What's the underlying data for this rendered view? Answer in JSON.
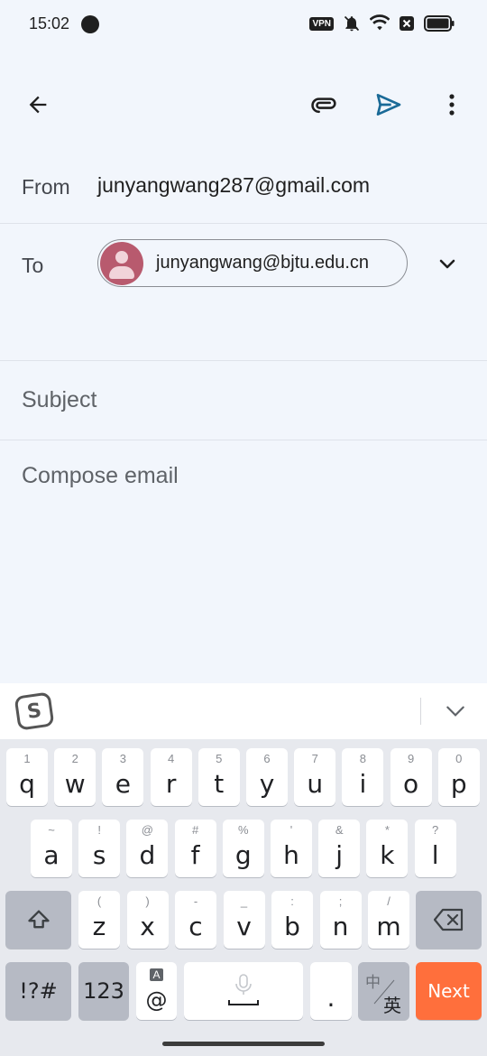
{
  "status_bar": {
    "time": "15:02",
    "vpn_label": "VPN",
    "icons": [
      "app-notification-icon",
      "vpn-icon",
      "mute-icon",
      "wifi-icon",
      "no-sim-icon",
      "battery-icon"
    ]
  },
  "toolbar": {
    "icons": [
      "back-arrow-icon",
      "attach-icon",
      "send-icon",
      "more-vert-icon"
    ],
    "accent_color": "#1a6a97"
  },
  "compose": {
    "from_label": "From",
    "from_value": "junyangwang287@gmail.com",
    "to_label": "To",
    "to_chip": "junyangwang@bjtu.edu.cn",
    "subject_placeholder": "Subject",
    "body_placeholder": "Compose email"
  },
  "keyboard": {
    "row1": [
      {
        "key": "q",
        "hint": "1"
      },
      {
        "key": "w",
        "hint": "2"
      },
      {
        "key": "e",
        "hint": "3"
      },
      {
        "key": "r",
        "hint": "4"
      },
      {
        "key": "t",
        "hint": "5"
      },
      {
        "key": "y",
        "hint": "6"
      },
      {
        "key": "u",
        "hint": "7"
      },
      {
        "key": "i",
        "hint": "8"
      },
      {
        "key": "o",
        "hint": "9"
      },
      {
        "key": "p",
        "hint": "0"
      }
    ],
    "row2": [
      {
        "key": "a",
        "hint": "~"
      },
      {
        "key": "s",
        "hint": "!"
      },
      {
        "key": "d",
        "hint": "@"
      },
      {
        "key": "f",
        "hint": "#"
      },
      {
        "key": "g",
        "hint": "%"
      },
      {
        "key": "h",
        "hint": "'"
      },
      {
        "key": "j",
        "hint": "&"
      },
      {
        "key": "k",
        "hint": "*"
      },
      {
        "key": "l",
        "hint": "?"
      }
    ],
    "row3": [
      {
        "key": "z",
        "hint": "("
      },
      {
        "key": "x",
        "hint": ")"
      },
      {
        "key": "c",
        "hint": "-"
      },
      {
        "key": "v",
        "hint": "_"
      },
      {
        "key": "b",
        "hint": ":"
      },
      {
        "key": "n",
        "hint": ";"
      },
      {
        "key": "m",
        "hint": "/"
      }
    ],
    "symbols_label": "!?#",
    "numbers_label": "123",
    "at_label": "@",
    "at_hint": "A",
    "period_label": ".",
    "lang_top": "中",
    "lang_bottom": "英",
    "next_label": "Next",
    "next_color": "#ff6f3c"
  }
}
